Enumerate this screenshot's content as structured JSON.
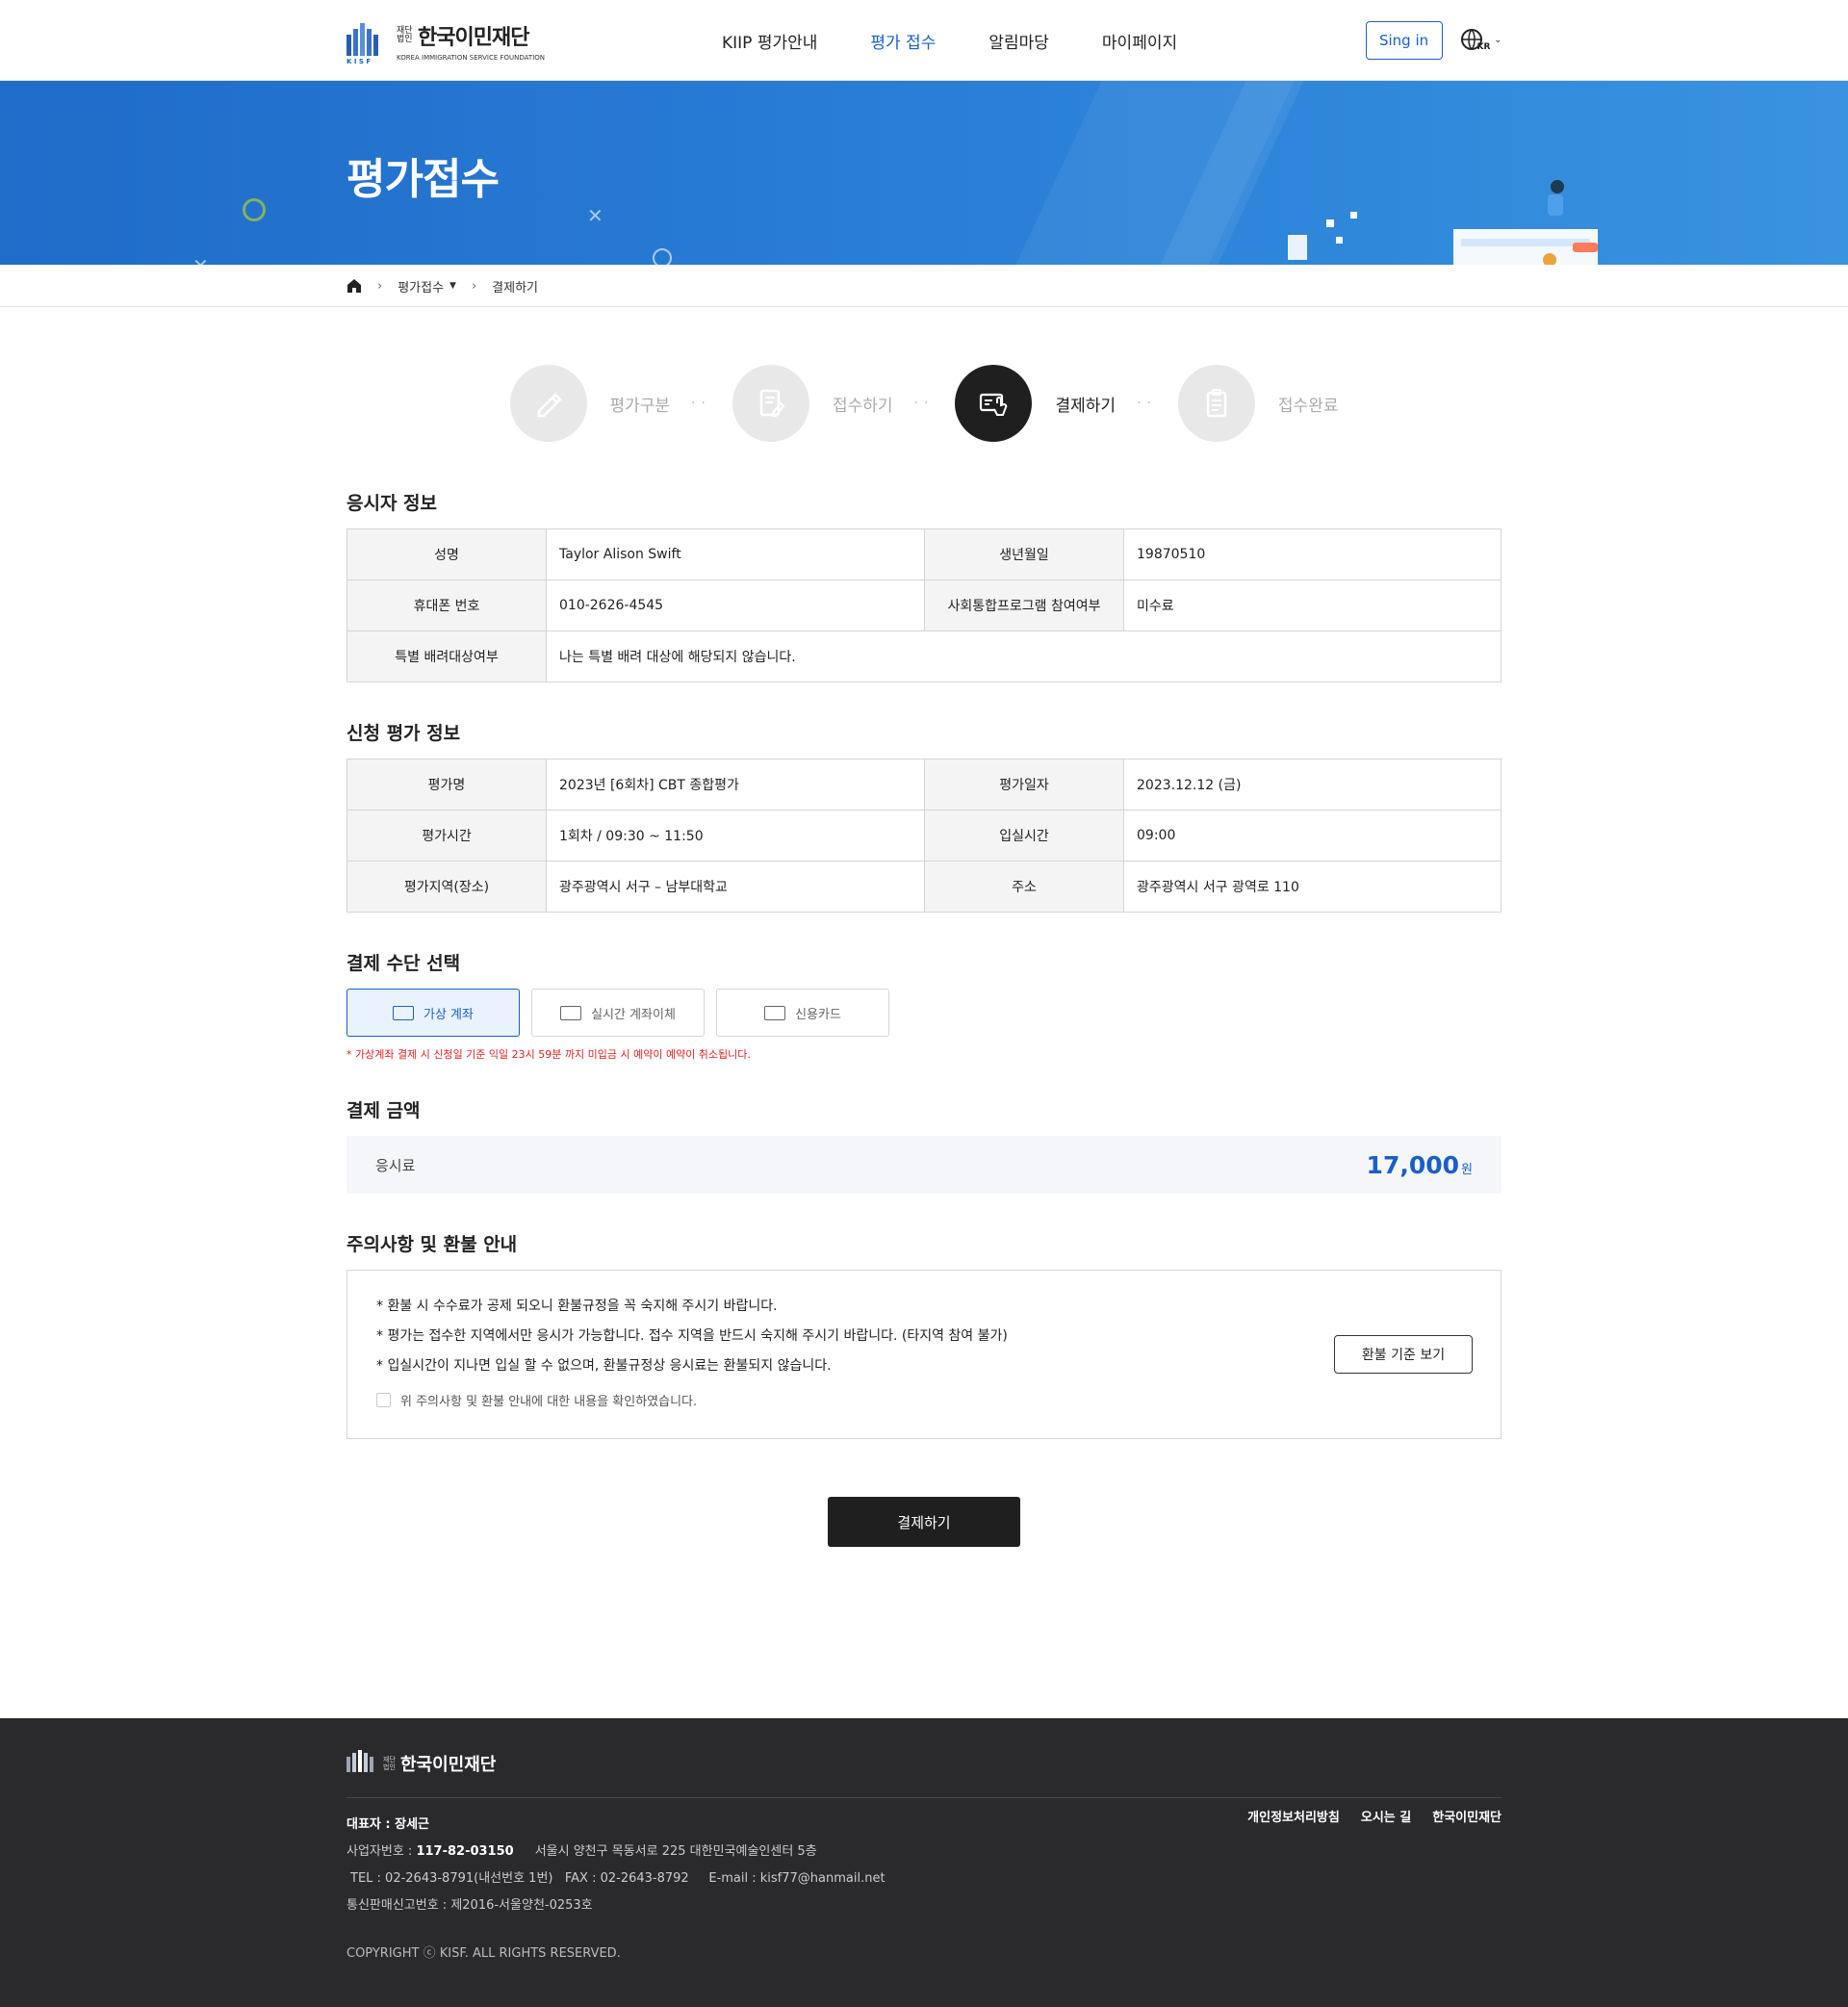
{
  "header": {
    "logo_small": "재단 법인",
    "logo_name": "한국이민재단",
    "logo_en": "KOREA IMMIGRATION SERVICE FOUNDATION",
    "logo_kisf": "K I S F",
    "nav": [
      "KIIP 평가안내",
      "평가 접수",
      "알림마당",
      "마이페이지"
    ],
    "active_nav": "평가 접수",
    "signin": "Sing in",
    "lang": "KR"
  },
  "banner": {
    "title": "평가접수"
  },
  "breadcrumb": {
    "items": [
      "평가접수",
      "결제하기"
    ]
  },
  "steps": [
    {
      "label": "평가구분",
      "icon": "pen-icon",
      "active": false
    },
    {
      "label": "접수하기",
      "icon": "document-edit-icon",
      "active": false
    },
    {
      "label": "결제하기",
      "icon": "payment-icon",
      "active": true
    },
    {
      "label": "접수완료",
      "icon": "clipboard-icon",
      "active": false
    }
  ],
  "applicant": {
    "title": "응시자 정보",
    "name_label": "성명",
    "name": "Taylor Alison Swift",
    "birth_label": "생년월일",
    "birth": "19870510",
    "phone_label": "휴대폰 번호",
    "phone": "010-2626-4545",
    "program_label": "사회통합프로그램 참여여부",
    "program": "미수료",
    "special_label": "특별 배려대상여부",
    "special": "나는 특별 배려 대상에 해당되지 않습니다."
  },
  "exam": {
    "title": "신청 평가 정보",
    "name_label": "평가명",
    "name": "2023년 [6회차] CBT 종합평가",
    "date_label": "평가일자",
    "date": "2023.12.12 (금)",
    "time_label": "평가시간",
    "time": "1회차 / 09:30 ~ 11:50",
    "entry_label": "입실시간",
    "entry": "09:00",
    "place_label": "평가지역(장소)",
    "place": "광주광역시 서구 – 남부대학교",
    "addr_label": "주소",
    "addr": "광주광역시 서구 광역로 110"
  },
  "payment": {
    "title": "결제 수단 선택",
    "methods": [
      "가상 계좌",
      "실시간 계좌이체",
      "신용카드"
    ],
    "selected": "가상 계좌",
    "warning": "* 가상계좌 결제 시 신청일 기준 익일 23시 59분 까지 미입금 시 예약이 예약이 취소됩니다."
  },
  "amount": {
    "title": "결제 금액",
    "label": "응시료",
    "value": "17,000",
    "unit": "원"
  },
  "notice": {
    "title": "주의사항 및 환불 안내",
    "lines": [
      "* 환불 시 수수료가 공제 되오니 환불규정을 꼭 숙지해 주시기 바랍니다.",
      "* 평가는 접수한 지역에서만 응시가 가능합니다. 접수 지역을 반드시 숙지해 주시기 바랍니다. (타지역 참여 불가)",
      "* 입실시간이 지나면 입실 할 수 없으며, 환불규정상 응시료는 환불되지 않습니다."
    ],
    "checkbox": "위 주의사항 및 환불 안내에 대한 내용을 확인하였습니다.",
    "refund_button": "환불 기준 보기"
  },
  "submit": "결제하기",
  "footer": {
    "ceo": "대표자 : 장세근",
    "biz_label": "사업자번호 : ",
    "biz": "117-82-03150",
    "address": "서울시 양천구 목동서로 225 대한민국예술인센터 5층",
    "contact": "TEL : 02-2643-8791(내선번호 1번)   FAX : 02-2643-8792     E-mail : kisf77@hanmail.net",
    "mail_order": "통신판매신고번호 : 제2016-서울양천-0253호",
    "links": [
      "개인정보처리방침",
      "오시는 길",
      "한국이민재단"
    ],
    "copyright": "COPYRIGHT ⓒ KISF. ALL RIGHTS RESERVED."
  },
  "colors": {
    "accent": "#1a5fc8",
    "banner": "#2b82d8",
    "dark": "#1f1f1f",
    "warning": "#e02020",
    "footer": "#2a2a2d"
  }
}
